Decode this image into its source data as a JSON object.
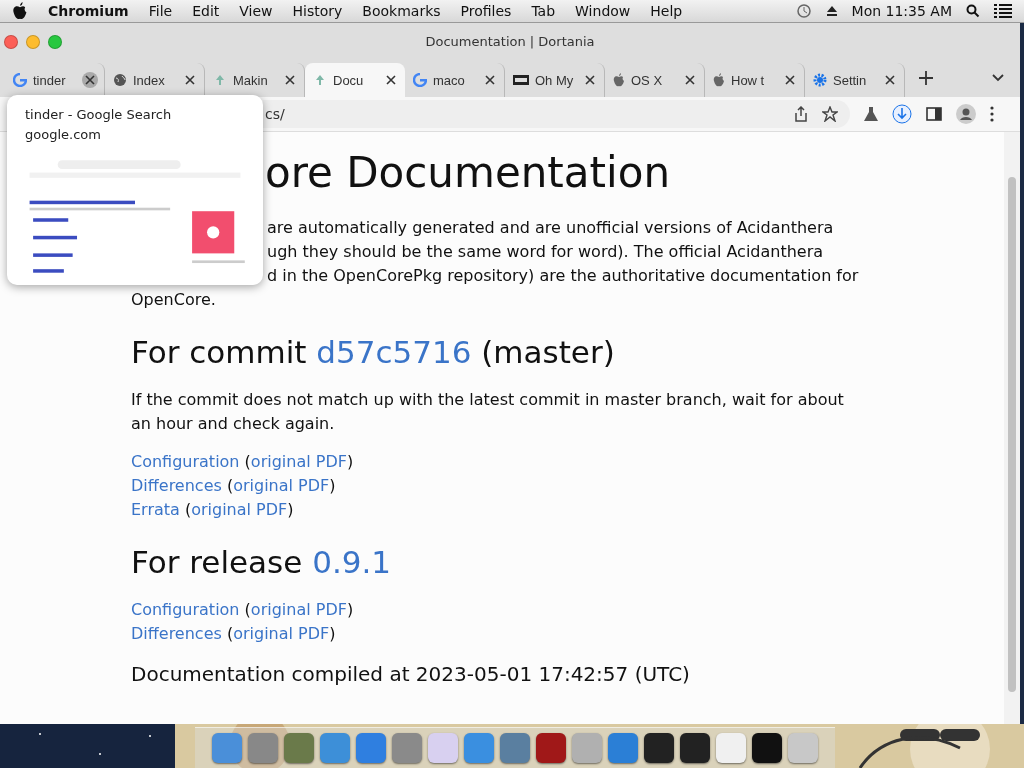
{
  "menubar": {
    "app": "Chromium",
    "menus": [
      "File",
      "Edit",
      "View",
      "History",
      "Bookmarks",
      "Profiles",
      "Tab",
      "Window",
      "Help"
    ],
    "clock": "Mon 11:35 AM"
  },
  "window": {
    "title": "Documentation | Dortania"
  },
  "tabs": [
    {
      "label": "tinder",
      "selected": false,
      "close_hovered": true
    },
    {
      "label": "Index",
      "selected": false,
      "close_hovered": false
    },
    {
      "label": "Makin",
      "selected": false,
      "close_hovered": false
    },
    {
      "label": "Docu",
      "selected": true,
      "close_hovered": false
    },
    {
      "label": "maco",
      "selected": false,
      "close_hovered": false
    },
    {
      "label": "Oh My",
      "selected": false,
      "close_hovered": false
    },
    {
      "label": "OS X",
      "selected": false,
      "close_hovered": false
    },
    {
      "label": "How t",
      "selected": false,
      "close_hovered": false
    },
    {
      "label": "Settin",
      "selected": false,
      "close_hovered": false
    }
  ],
  "address": {
    "text": "cs/"
  },
  "tab_preview": {
    "title": "tinder - Google Search",
    "domain": "google.com"
  },
  "page": {
    "heading": "ore Documentation",
    "intro_lines": [
      "are automatically generated and are unofficial versions of Acidanthera",
      "ugh they should be the same word for word). The official Acidanthera",
      "d in the OpenCorePkg repository) are the authoritative documentation for",
      "OpenCore."
    ],
    "sections": [
      {
        "heading": [
          {
            "text": "For commit ",
            "link": false
          },
          {
            "text": "d57c5716",
            "link": true
          },
          {
            "text": " (master)",
            "link": false
          }
        ],
        "paragraph": "If the commit does not match up with the latest commit in master branch, wait for about an hour and check again.",
        "links": [
          [
            {
              "text": "Configuration",
              "link": true
            },
            {
              "text": " (",
              "link": false
            },
            {
              "text": "original PDF",
              "link": true
            },
            {
              "text": ")",
              "link": false
            }
          ],
          [
            {
              "text": "Differences",
              "link": true
            },
            {
              "text": " (",
              "link": false
            },
            {
              "text": "original PDF",
              "link": true
            },
            {
              "text": ")",
              "link": false
            }
          ],
          [
            {
              "text": "Errata",
              "link": true
            },
            {
              "text": " (",
              "link": false
            },
            {
              "text": "original PDF",
              "link": true
            },
            {
              "text": ")",
              "link": false
            }
          ]
        ]
      },
      {
        "heading": [
          {
            "text": "For release ",
            "link": false
          },
          {
            "text": "0.9.1",
            "link": true
          }
        ],
        "links": [
          [
            {
              "text": "Configuration",
              "link": true
            },
            {
              "text": " (",
              "link": false
            },
            {
              "text": "original PDF",
              "link": true
            },
            {
              "text": ")",
              "link": false
            }
          ],
          [
            {
              "text": "Differences",
              "link": true
            },
            {
              "text": " (",
              "link": false
            },
            {
              "text": "original PDF",
              "link": true
            },
            {
              "text": ")",
              "link": false
            }
          ]
        ]
      }
    ],
    "footer": "Documentation compiled at 2023-05-01 17:42:57 (UTC)"
  }
}
